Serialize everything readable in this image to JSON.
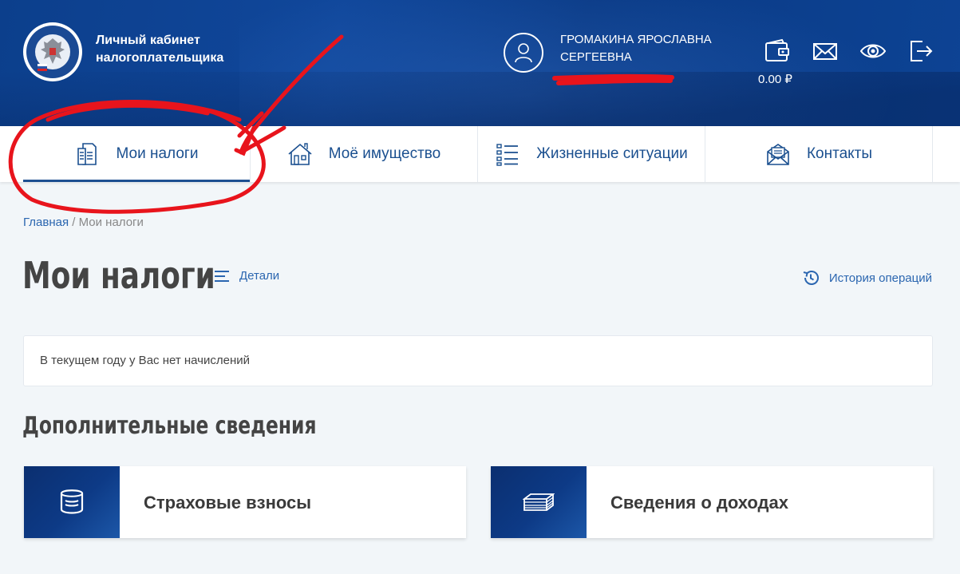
{
  "header": {
    "brand_line1": "Личный кабинет",
    "brand_line2": "налогоплательщика",
    "user_line1": "ГРОМАКИНА ЯРОСЛАВНА",
    "user_line2": "СЕРГЕЕВНА",
    "balance": "0.00 ₽",
    "icons": [
      "wallet-icon",
      "mail-icon",
      "eye-icon",
      "logout-icon"
    ]
  },
  "nav": {
    "tabs": [
      {
        "label": "Мои налоги",
        "icon": "documents-icon",
        "active": true
      },
      {
        "label": "Моё имущество",
        "icon": "house-icon",
        "active": false
      },
      {
        "label": "Жизненные ситуации",
        "icon": "list-icon",
        "active": false
      },
      {
        "label": "Контакты",
        "icon": "envelope-icon",
        "active": false
      }
    ]
  },
  "breadcrumb": {
    "home": "Главная",
    "separator": " / ",
    "current": "Мои налоги"
  },
  "main": {
    "title": "Мои налоги",
    "details_link": "Детали",
    "history_link": "История операций",
    "notice": "В текущем году у Вас нет начислений",
    "section_title": "Дополнительные сведения",
    "cards": [
      {
        "label": "Страховые взносы",
        "icon": "coins-stack-icon"
      },
      {
        "label": "Сведения о доходах",
        "icon": "money-stack-icon"
      }
    ]
  },
  "colors": {
    "header_blue": "#10479b",
    "link_blue": "#2b66b0",
    "annotation_red": "#e8141c"
  }
}
